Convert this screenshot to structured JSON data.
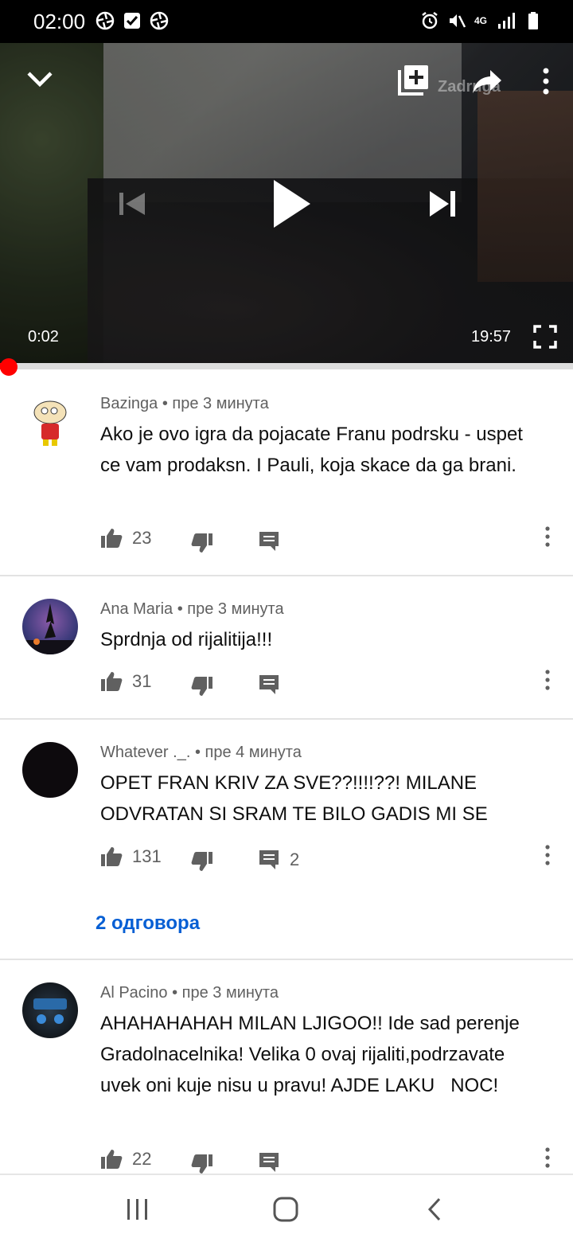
{
  "status_bar": {
    "time": "02:00",
    "left_icons": [
      "aperture-icon",
      "check-box-icon",
      "aperture-icon"
    ],
    "right_icons": [
      "alarm-icon",
      "mute-icon",
      "network-4g-icon",
      "signal-icon",
      "battery-icon"
    ],
    "network_label": "4G"
  },
  "player": {
    "current_time": "0:02",
    "duration": "19:57",
    "watermark": "Zadruga",
    "progress_fraction": 0.001
  },
  "comments": [
    {
      "author": "Bazinga",
      "time": "пре 3 минута",
      "text": "Ako je ovo igra da pojacate Franu podrsku - uspet ce vam prodaksn. I Pauli, koja skace da ga brani.",
      "likes": "23",
      "reply_count": "",
      "avatar_color": "#f4e6b8"
    },
    {
      "author": "Ana Maria",
      "time": "пре 3 минута",
      "text": "Sprdnja od rijalitija!!!",
      "likes": "31",
      "reply_count": "",
      "avatar_color": "#4a4a9a"
    },
    {
      "author": "Whatever ._.",
      "time": "пре 4 минута",
      "text": "OPET FRAN KRIV ZA SVE??!!!!??! MILANE ODVRATAN SI SRAM TE BILO GADIS MI SE",
      "likes": "131",
      "reply_count": "2",
      "replies_link": "2 одговора",
      "avatar_color": "#0d0a0d"
    },
    {
      "author": "Al Pacino",
      "time": "пре 3 минута",
      "text": "AHAHAHAHAH MILAN LJIGOO!! Ide sad perenje Gradolnacelnika! Velika 0 ovaj rijaliti,podrzavate uvek oni kuje nisu u pravu! AJDE LAKU   NOC!",
      "likes": "22",
      "reply_count": "",
      "avatar_color": "#1a2430"
    }
  ],
  "colors": {
    "accent_red": "#ff0000",
    "link_blue": "#065fd4",
    "meta_gray": "#606060"
  }
}
